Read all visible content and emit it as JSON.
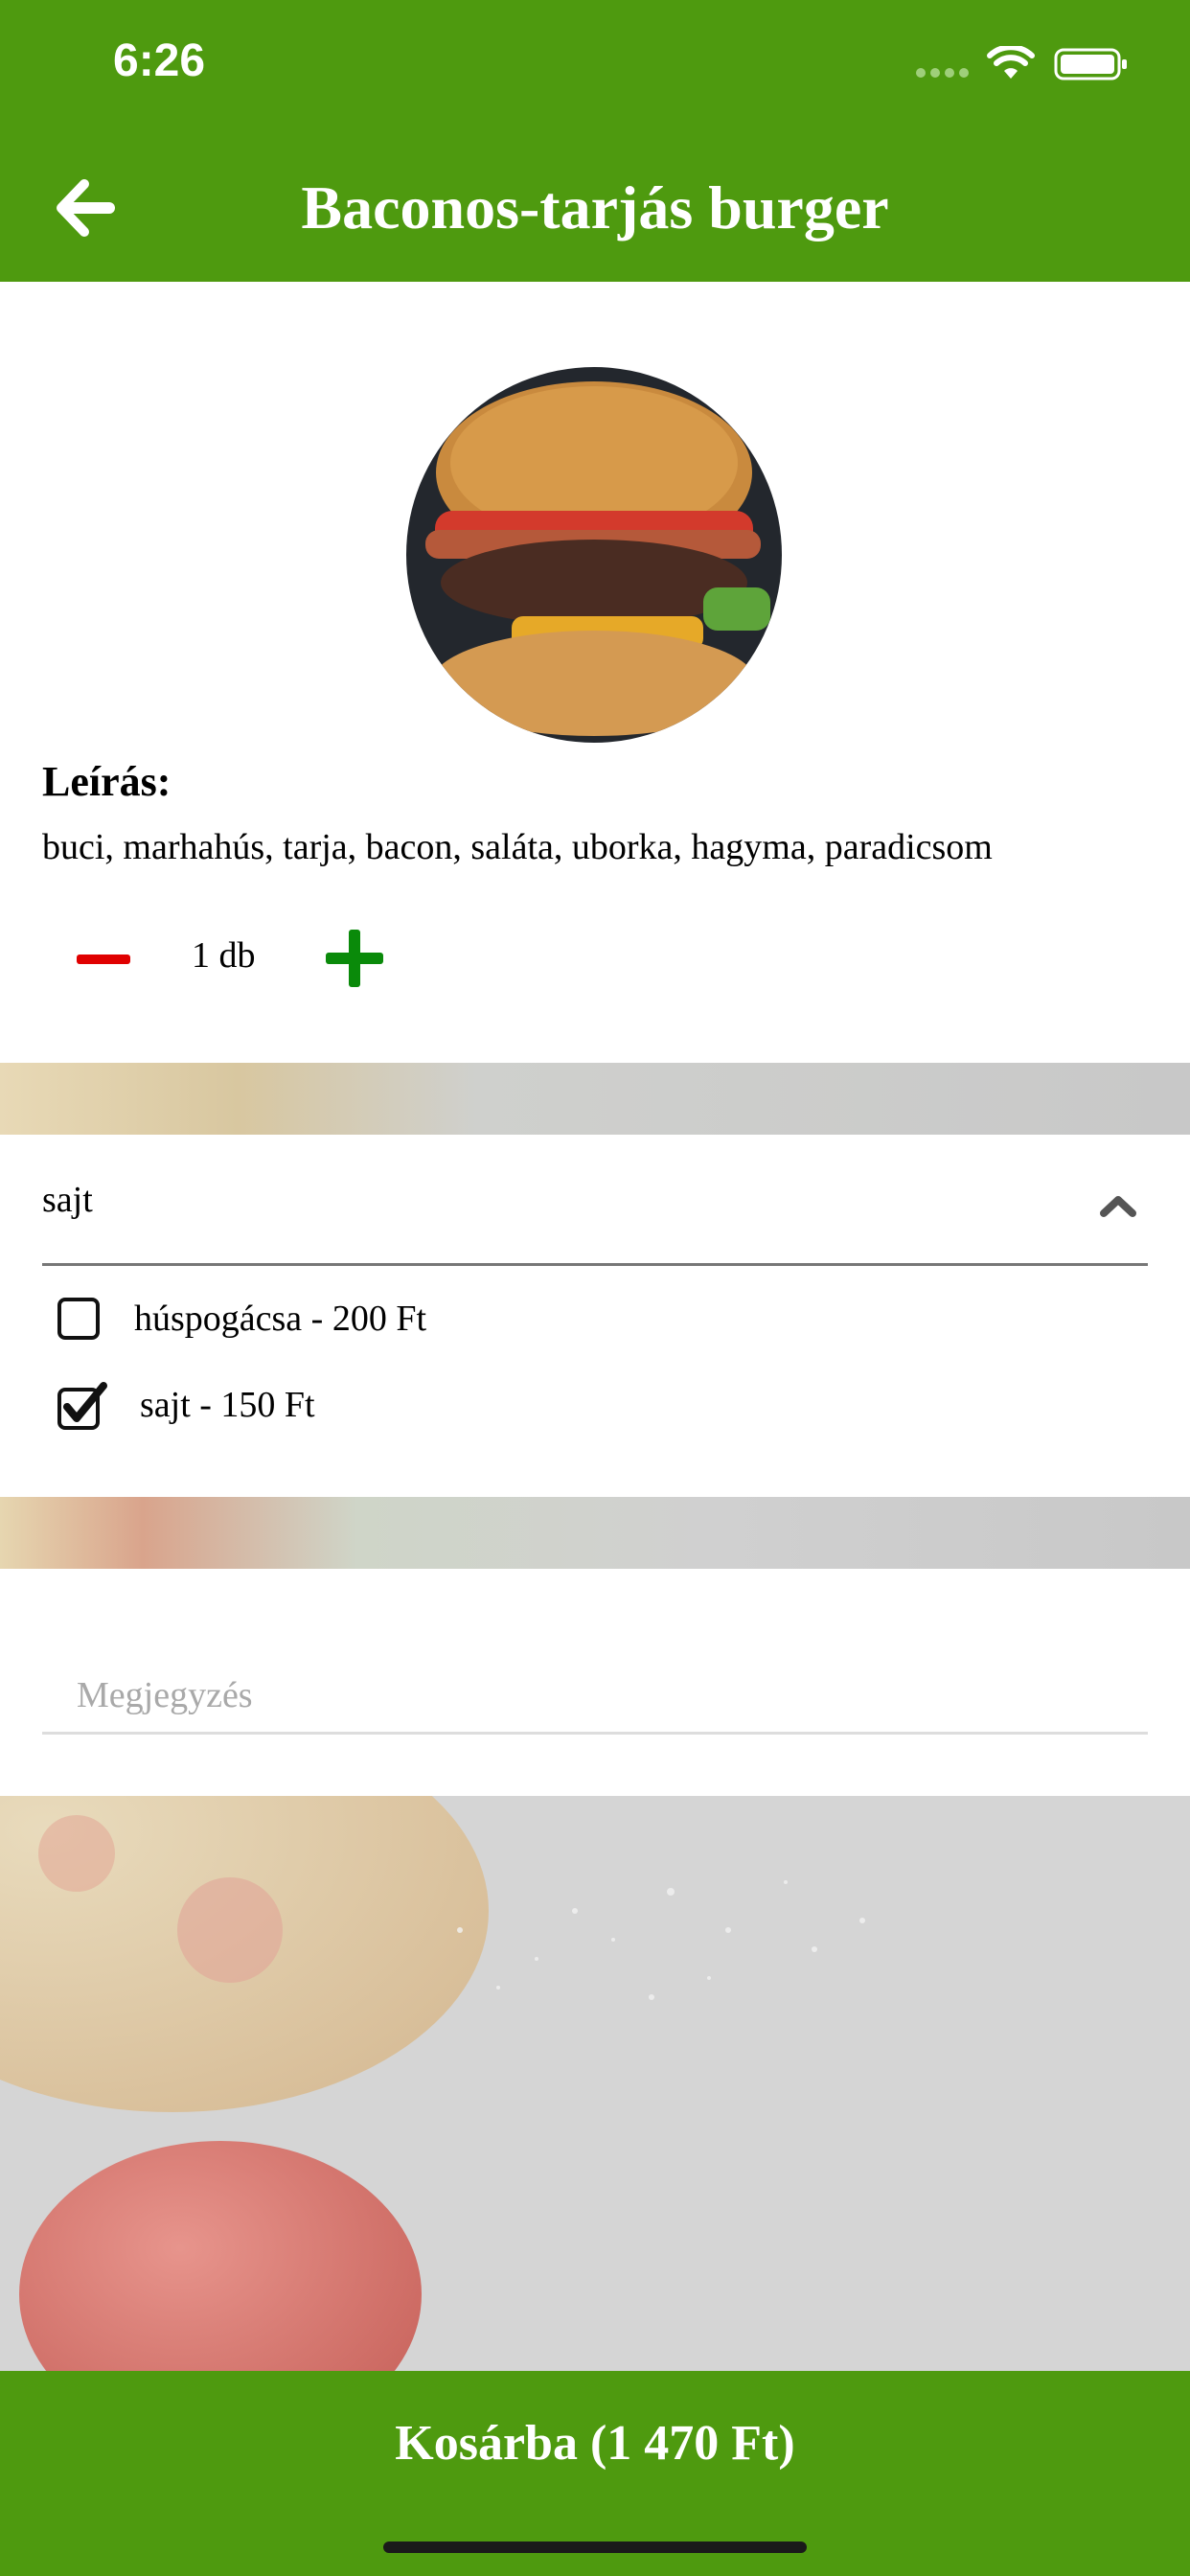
{
  "status_bar": {
    "time": "6:26"
  },
  "header": {
    "title": "Baconos-tarjás burger"
  },
  "product": {
    "description_label": "Leírás:",
    "description": "buci, marhahús, tarja, bacon, saláta, uborka, hagyma, paradicsom",
    "quantity": "1 db"
  },
  "options": {
    "title": "sajt",
    "items": [
      {
        "label": "húspogácsa - 200 Ft",
        "checked": false
      },
      {
        "label": "sajt - 150 Ft",
        "checked": true
      }
    ]
  },
  "note": {
    "placeholder": "Megjegyzés",
    "value": ""
  },
  "cart_button": {
    "label": "Kosárba (1 470 Ft)"
  },
  "colors": {
    "brand_green": "#4e9a0f",
    "minus_red": "#e00000",
    "plus_green": "#0a8a0a"
  }
}
